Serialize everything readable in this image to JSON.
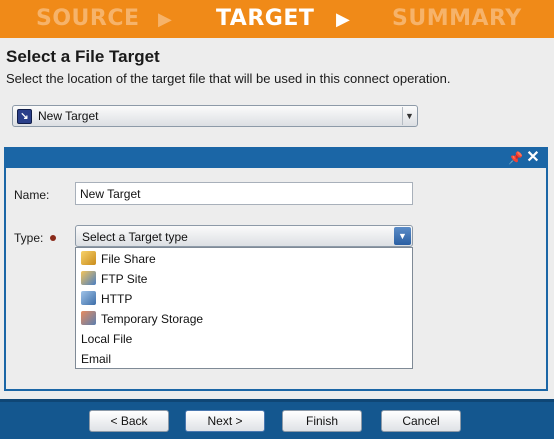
{
  "wizard_steps": [
    {
      "label": "SOURCE",
      "state": "inactive"
    },
    {
      "label": "TARGET",
      "state": "active"
    },
    {
      "label": "SUMMARY",
      "state": "inactive"
    }
  ],
  "header": {
    "title": "Select a File Target",
    "subtitle": "Select the location of the target file that will be used in this connect operation."
  },
  "target_selector": {
    "value": "New Target",
    "icon": "target-file-icon"
  },
  "panel": {
    "name_label": "Name:",
    "name_value": "New Target",
    "type_label": "Type:",
    "type_placeholder": "Select a Target type",
    "type_options": [
      {
        "label": "File Share",
        "icon": "file-share-icon"
      },
      {
        "label": "FTP Site",
        "icon": "ftp-site-icon"
      },
      {
        "label": "HTTP",
        "icon": "http-icon"
      },
      {
        "label": "Temporary Storage",
        "icon": "temporary-storage-icon"
      },
      {
        "label": "Local File",
        "icon": ""
      },
      {
        "label": "Email",
        "icon": ""
      }
    ]
  },
  "footer": {
    "back_label": "< Back",
    "next_label": "Next >",
    "finish_label": "Finish",
    "cancel_label": "Cancel"
  },
  "colors": {
    "header_orange": "#f08a18",
    "accent_blue": "#1b66a6",
    "footer_blue": "#14578f",
    "required_dot": "#8a2a1a"
  }
}
